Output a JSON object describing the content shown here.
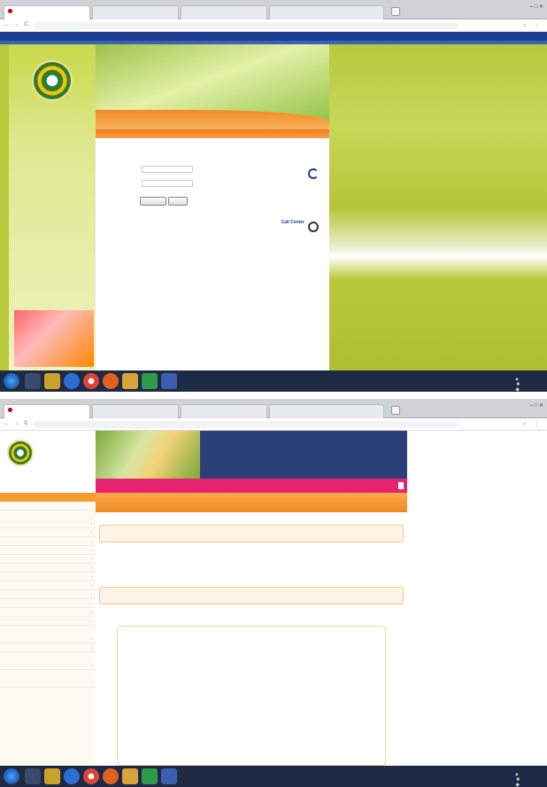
{
  "shot1": {
    "tabs": [
      "",
      "",
      "",
      ""
    ],
    "url": "",
    "sidebar": {
      "org_name": "",
      "banner_text": "",
      "links": []
    },
    "header": {
      "subtitle": "",
      "title": ""
    },
    "login": {
      "heading": "",
      "username_label": "",
      "password_label": "",
      "login_button": "",
      "reset_button": "",
      "warning": ""
    },
    "contact": {
      "heading": "",
      "lines": [
        "",
        "",
        "",
        ""
      ]
    },
    "callcenter": {
      "title": "Call Center",
      "number": ""
    },
    "red_link": "",
    "taskbar_time": "",
    "taskbar_date": ""
  },
  "shot2": {
    "tabs": [
      "",
      "",
      "",
      ""
    ],
    "url": "",
    "logo": {
      "line1": "",
      "line2": ""
    },
    "infobox": [
      "",
      "",
      "",
      "",
      ""
    ],
    "pink_bar": "",
    "pink_tag": "",
    "left_nav": {
      "header": "",
      "sections": []
    },
    "main": {
      "heading1": "",
      "heading2": "",
      "notice_lines": [
        "",
        ""
      ]
    },
    "card": {
      "org_lines": [
        "",
        ""
      ],
      "address_lines": [
        "",
        ""
      ],
      "stats": []
    },
    "taskbar_time": "",
    "taskbar_date": ""
  },
  "icons": {
    "browser_nav": "← → C",
    "toolbar": "☆ ⋮",
    "window_controls": "– □ ✕",
    "tray": "▲ ■ ◆"
  },
  "colors": {
    "site_green": "#b8c93b",
    "site_orange": "#f37a1f",
    "site_blue": "#1c3d8f",
    "pink_bar": "#e6246e",
    "taskbar": "#1e2a44"
  }
}
